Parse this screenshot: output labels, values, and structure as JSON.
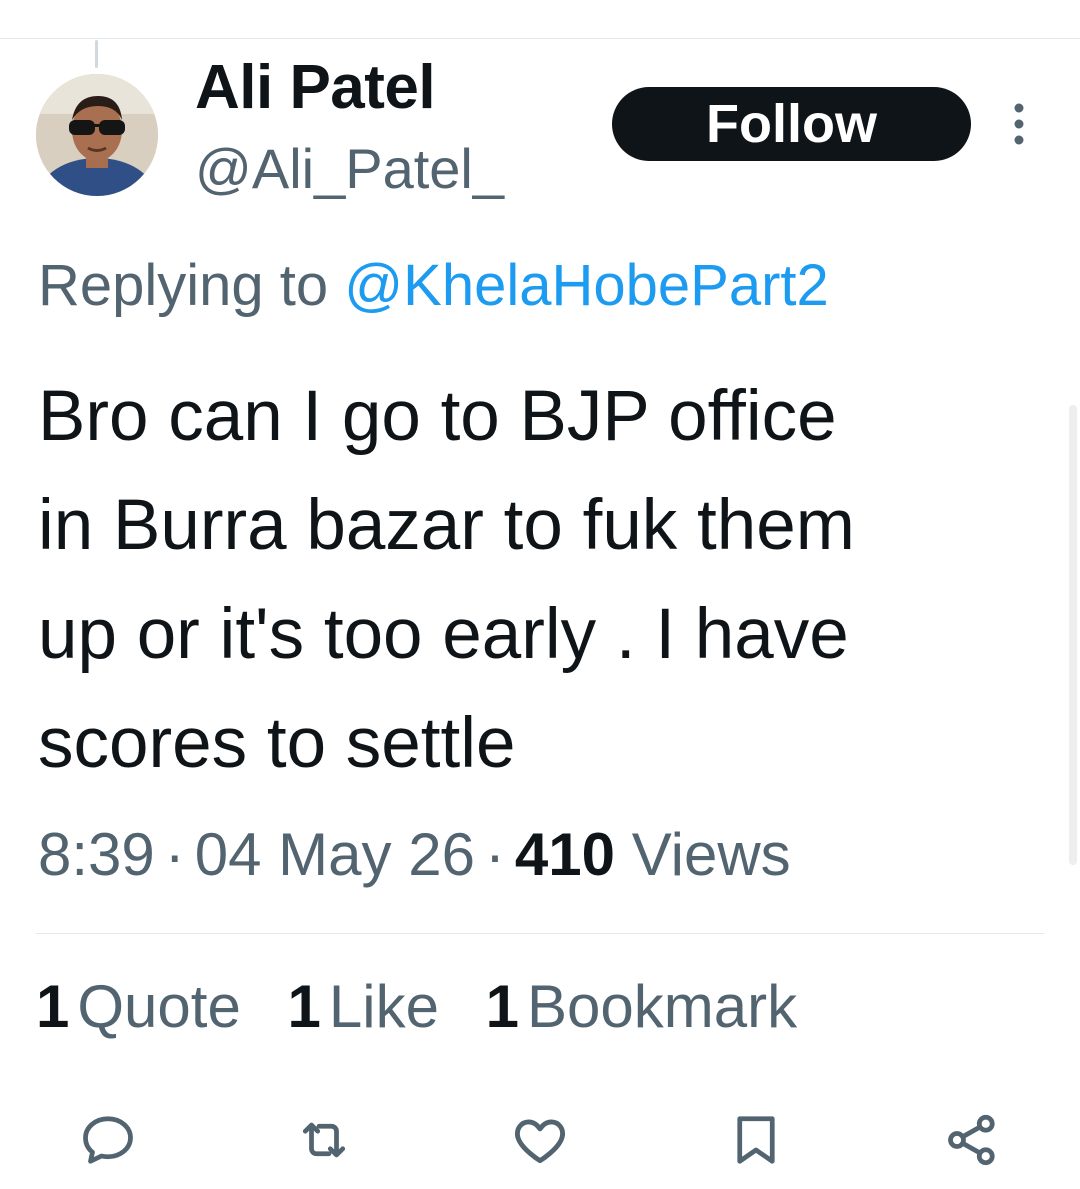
{
  "user": {
    "display_name": "Ali Patel",
    "handle": "@Ali_Patel_"
  },
  "follow_button": {
    "label": "Follow"
  },
  "reply": {
    "prefix": "Replying to ",
    "mention": "@KhelaHobePart2"
  },
  "tweet": {
    "lines": [
      "Bro can I go to BJP office",
      "in Burra bazar to fuk them",
      "up or it's too early . I have",
      "scores to settle"
    ]
  },
  "meta": {
    "time": "8:39",
    "separator": "·",
    "date": "04 May 26",
    "views_count": "410",
    "views_label": "Views"
  },
  "stats": {
    "quotes": {
      "count": "1",
      "label": "Quote"
    },
    "likes": {
      "count": "1",
      "label": "Like"
    },
    "bookmarks": {
      "count": "1",
      "label": "Bookmark"
    }
  },
  "icons": {
    "actions": [
      "reply-icon",
      "retweet-icon",
      "like-icon",
      "bookmark-icon",
      "share-icon"
    ],
    "more": "more-vertical-icon"
  },
  "colors": {
    "text_primary": "#0f1419",
    "text_secondary": "#536471",
    "link": "#1d9bf0",
    "follow_button_bg": "#0f1419",
    "divider": "#e6e9ec"
  }
}
